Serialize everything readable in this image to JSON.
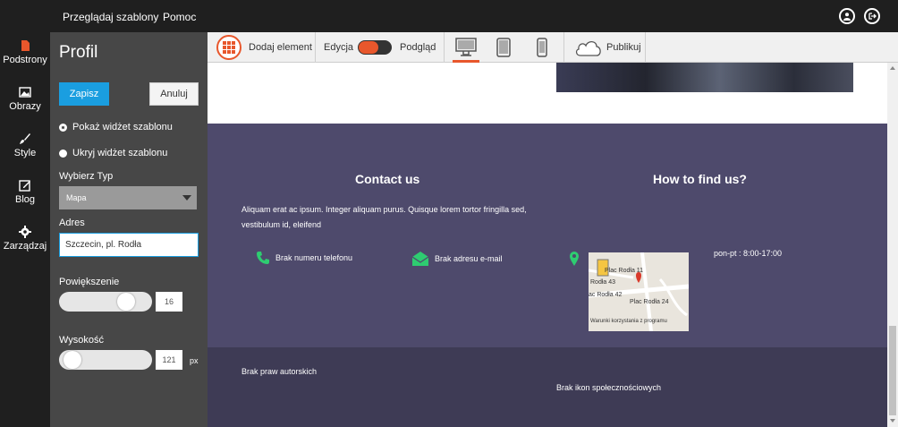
{
  "topbar": {
    "nav": [
      "Przeglądaj szablony",
      "Pomoc"
    ],
    "icons": [
      "user-icon",
      "logout-icon"
    ]
  },
  "rail": [
    {
      "label": "Podstrony",
      "icon": "page-icon",
      "active": true
    },
    {
      "label": "Obrazy",
      "icon": "image-icon"
    },
    {
      "label": "Style",
      "icon": "brush-icon"
    },
    {
      "label": "Blog",
      "icon": "edit-icon"
    },
    {
      "label": "Zarządzaj",
      "icon": "gear-icon"
    }
  ],
  "panel": {
    "title": "Profil",
    "save": "Zapisz",
    "cancel": "Anuluj",
    "radio_show": "Pokaż widżet szablonu",
    "radio_hide": "Ukryj widżet szablonu",
    "type_label": "Wybierz Typ",
    "type_value": "Mapa",
    "address_label": "Adres",
    "address_value": "Szczecin, pl. Rodła",
    "zoom_label": "Powiększenie",
    "zoom_value": "16",
    "zoom_fraction": 0.78,
    "height_label": "Wysokość",
    "height_value": "121",
    "height_fraction": 0.05,
    "height_unit": "px"
  },
  "toolbar": {
    "add_element": "Dodaj element",
    "edit": "Edycja",
    "preview": "Podgląd",
    "publish": "Publikuj",
    "devices": [
      "desktop-icon",
      "tablet-icon",
      "mobile-icon"
    ]
  },
  "canvas": {
    "contact_title": "Contact us",
    "find_title": "How to find us?",
    "paragraph": "Aliquam erat ac ipsum. Integer aliquam purus. Quisque lorem tortor fringilla sed, vestibulum id, eleifend",
    "phone": "Brak numeru telefonu",
    "email": "Brak adresu e-mail",
    "hours": "pon-pt : 8:00-17:00",
    "map_labels": [
      "Plac Rodła 11",
      "Rodła 43",
      "ac Rodła 42",
      "Plac Rodła 24",
      "Warunki korzystania z programu"
    ],
    "copyright": "Brak praw autorskich",
    "social": "Brak ikon społecznościowych"
  },
  "colors": {
    "accent": "#1a9ee0",
    "orange": "#e8572c",
    "footer": "#4e4a6c",
    "footer_dark": "#3e3b55",
    "green": "#2ecc71"
  }
}
